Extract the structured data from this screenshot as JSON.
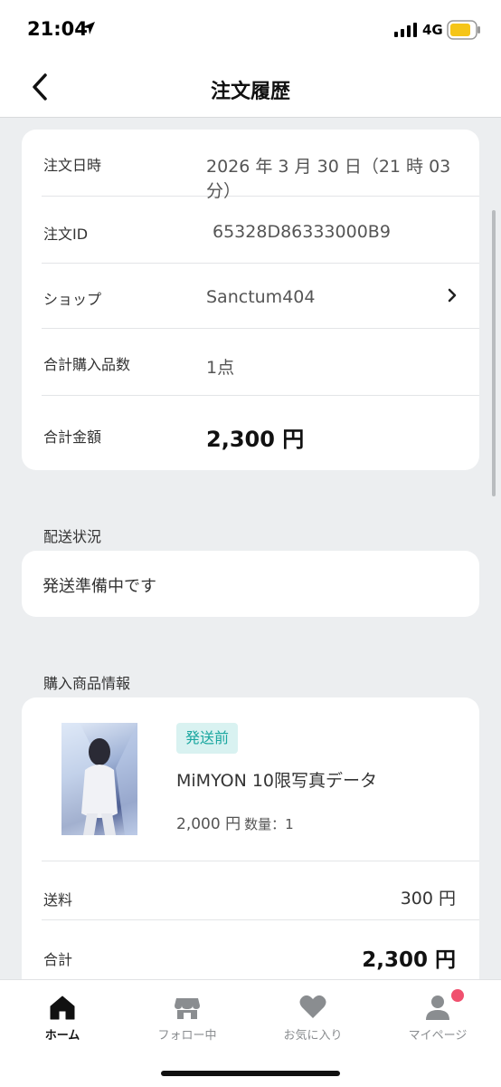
{
  "status_bar": {
    "time": "21:04",
    "network": "4G"
  },
  "nav": {
    "title": "注文履歴"
  },
  "order_info": {
    "rows": [
      {
        "label": "注文日時",
        "value": "2026 年 3 月 30 日（21 時 03 分）"
      },
      {
        "label": "注文ID",
        "value": "65328D86333000B9"
      },
      {
        "label": "ショップ",
        "value": "Sanctum404"
      },
      {
        "label": "合計購入品数",
        "value": "1点"
      },
      {
        "label": "合計金額",
        "value": "2,300 円"
      }
    ]
  },
  "shipping": {
    "title": "配送状況",
    "status": "発送準備中です"
  },
  "product_section": {
    "title": "購入商品情報",
    "badge": "発送前",
    "name": "MiMYON 10限写真データ",
    "price": "2,000 円",
    "quantity": "数量：1",
    "shipping_fee_label": "送料",
    "shipping_fee_value": "300 円",
    "total_label": "合計",
    "total_value": "2,300 円"
  },
  "tabs": [
    {
      "label": "ホーム",
      "icon": "home-icon",
      "active": true
    },
    {
      "label": "フォロー中",
      "icon": "shop-icon",
      "active": false
    },
    {
      "label": "お気に入り",
      "icon": "heart-icon",
      "active": false
    },
    {
      "label": "マイページ",
      "icon": "person-icon",
      "active": false
    }
  ],
  "colors": {
    "accent": "#1ba7a0",
    "badge_bg": "#d9f2f1",
    "notification": "#f0506e",
    "background": "#eceef0"
  }
}
